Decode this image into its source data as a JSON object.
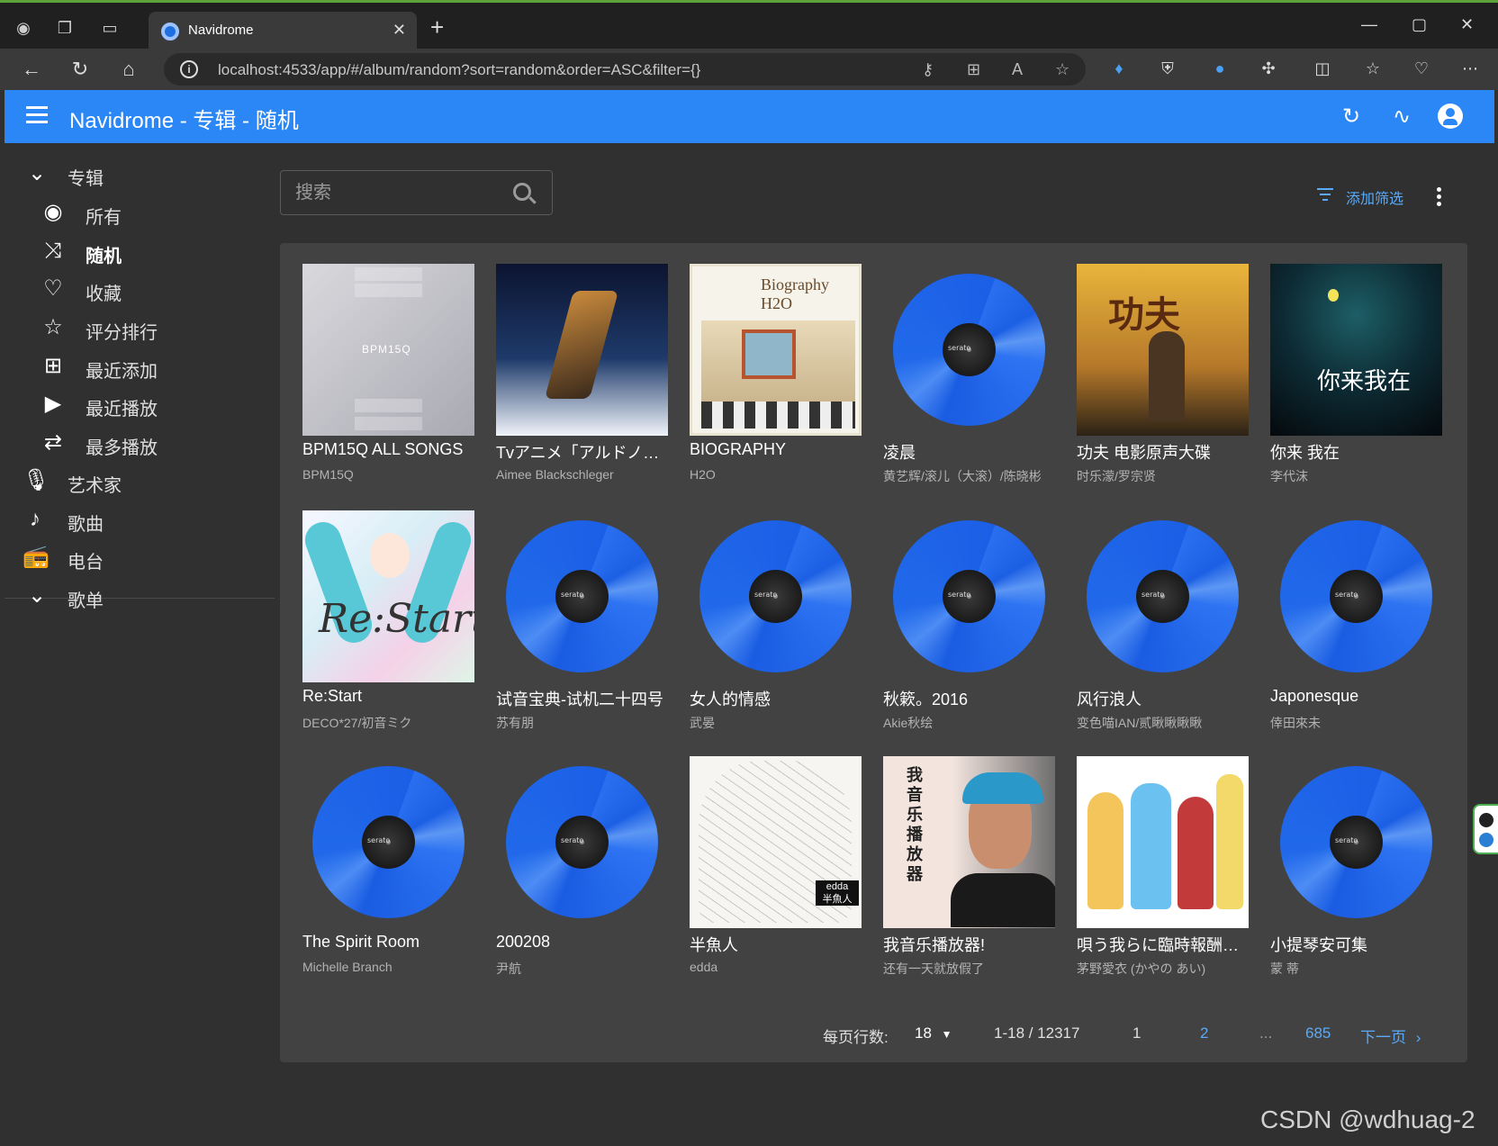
{
  "browser": {
    "tab_title": "Navidrome",
    "url": "localhost:4533/app/#/album/random?sort=random&order=ASC&filter={}"
  },
  "appbar": {
    "title": "Navidrome - 专辑 - 随机"
  },
  "sidebar": {
    "albums_header": "专辑",
    "items": [
      {
        "label": "所有",
        "icon": "album-icon"
      },
      {
        "label": "随机",
        "icon": "shuffle-icon",
        "active": true
      },
      {
        "label": "收藏",
        "icon": "heart-icon"
      },
      {
        "label": "评分排行",
        "icon": "star-icon"
      },
      {
        "label": "最近添加",
        "icon": "library-add-icon"
      },
      {
        "label": "最近播放",
        "icon": "video-library-icon"
      },
      {
        "label": "最多播放",
        "icon": "repeat-icon"
      }
    ],
    "artists": "艺术家",
    "songs": "歌曲",
    "radio": "电台",
    "playlists_header": "歌单"
  },
  "search": {
    "placeholder": "搜索"
  },
  "filter": {
    "label": "添加筛选"
  },
  "albums": [
    {
      "title": "BPM15Q ALL SONGS",
      "artist": "BPM15Q",
      "art": "gray"
    },
    {
      "title": "Tvアニメ「アルドノア・ゼロ」オリジナルサウンドトラック",
      "artist": "Aimee Blackschleger",
      "art": "mech"
    },
    {
      "title": "BIOGRAPHY",
      "artist": "H2O",
      "art": "h2o"
    },
    {
      "title": "凌晨",
      "artist": "黄艺辉/滚儿（大滚）/陈晓彬",
      "art": "vinyl"
    },
    {
      "title": "功夫 电影原声大碟",
      "artist": "时乐濛/罗宗贤",
      "art": "kungfu"
    },
    {
      "title": "你来 我在",
      "artist": "李代沫",
      "art": "night"
    },
    {
      "title": "Re:Start",
      "artist": "DECO*27/初音ミク",
      "art": "miku"
    },
    {
      "title": "试音宝典-试机二十四号",
      "artist": "苏有朋",
      "art": "vinyl"
    },
    {
      "title": "女人的情感",
      "artist": "武晏",
      "art": "vinyl"
    },
    {
      "title": "秋簌。2016",
      "artist": "Akie秋绘",
      "art": "vinyl"
    },
    {
      "title": "风行浪人",
      "artist": "变色喵IAN/贰瞅瞅瞅瞅",
      "art": "vinyl"
    },
    {
      "title": "Japonesque",
      "artist": "倖田來未",
      "art": "vinyl"
    },
    {
      "title": "The Spirit Room",
      "artist": "Michelle Branch",
      "art": "vinyl"
    },
    {
      "title": "200208",
      "artist": "尹航",
      "art": "vinyl"
    },
    {
      "title": "半魚人",
      "artist": "edda",
      "art": "sketch"
    },
    {
      "title": "我音乐播放器!",
      "artist": "还有一天就放假了",
      "art": "cena"
    },
    {
      "title": "唄う我らに臨時報酬を！！",
      "artist": "茅野愛衣 (かやの あい)",
      "art": "anime"
    },
    {
      "title": "小提琴安可集",
      "artist": "蒙 蒂",
      "art": "vinyl"
    }
  ],
  "pagination": {
    "rows_label": "每页行数:",
    "rows_value": "18",
    "range": "1-18 / 12317",
    "page1": "1",
    "page2": "2",
    "ellipsis": "...",
    "last": "685",
    "next": "下一页"
  },
  "watermark": "CSDN @wdhuag-2",
  "colors": {
    "appbar": "#2b87f5",
    "accent": "#5aaaf7",
    "background": "#303030",
    "panel": "#424242"
  }
}
